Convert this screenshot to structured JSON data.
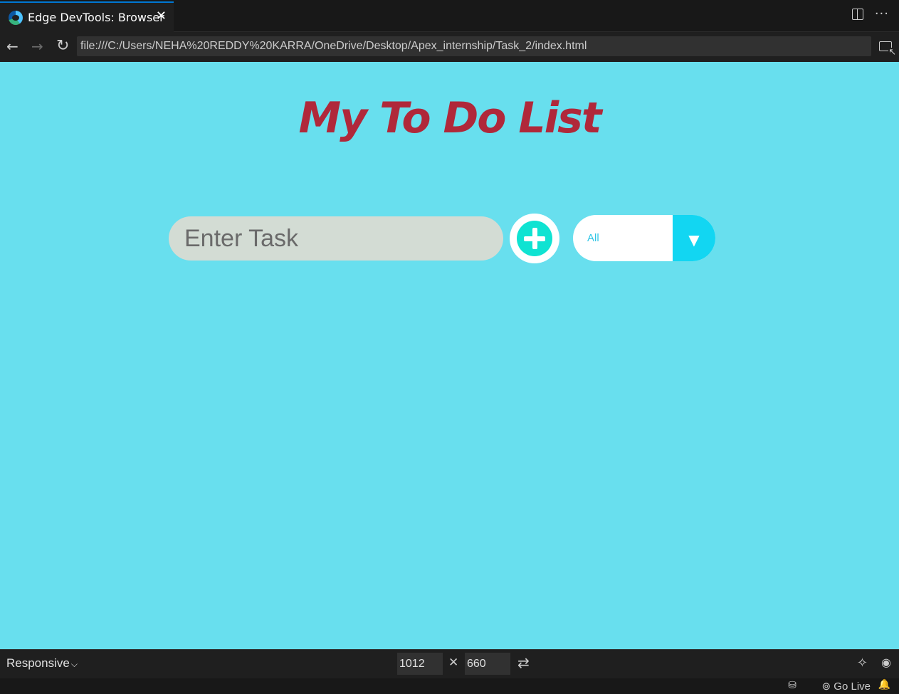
{
  "tab": {
    "title": "Edge DevTools: Browser",
    "close_glyph": "✕",
    "more_glyph": "···"
  },
  "navbar": {
    "back_glyph": "←",
    "forward_glyph": "→",
    "reload_glyph": "↻",
    "url": "file:///C:/Users/NEHA%20REDDY%20KARRA/OneDrive/Desktop/Apex_internship/Task_2/index.html"
  },
  "page": {
    "background_color": "#68dfee",
    "title": "My To Do List",
    "title_color": "#b0283a",
    "task_input": {
      "placeholder": "Enter Task",
      "value": ""
    },
    "filter": {
      "selected": "All",
      "arrow_glyph": "▼"
    }
  },
  "devtools_bar": {
    "device": "Responsive",
    "chevron_glyph": "⌵",
    "width": "1012",
    "height": "660",
    "times_glyph": "✕",
    "swap_glyph": "⇄",
    "wand_glyph": "✧",
    "eye_glyph": "◉"
  },
  "statusbar": {
    "copilot_glyph": "⛁",
    "go_live": "Go Live",
    "go_live_glyph": "⊚",
    "bell_glyph": "🔔"
  }
}
